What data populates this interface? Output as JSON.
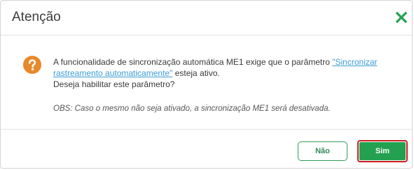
{
  "dialog": {
    "title": "Atenção",
    "close_icon": "close-icon",
    "message": {
      "part1": "A funcionalidade de sincronização automática ME1 exige que o parâmetro ",
      "link_open_quote": "\"",
      "link_text": "Sincronizar rastreamento automaticamente",
      "link_close_quote": "\"",
      "part2": " esteja ativo.",
      "line2": "Deseja habilitar este parâmetro?"
    },
    "obs": "OBS: Caso o mesmo não seja ativado, a sincronização ME1 será desativada.",
    "buttons": {
      "no_label": "Não",
      "yes_label": "Sim"
    }
  },
  "colors": {
    "accent_green": "#24a150",
    "question_icon": "#e8892b",
    "link": "#3b9ed6",
    "focus_outline": "#cc1f1f"
  }
}
